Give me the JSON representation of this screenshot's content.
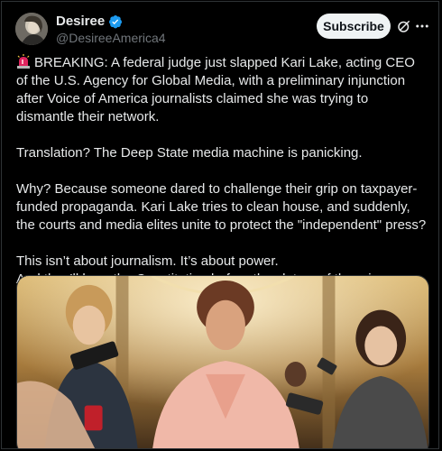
{
  "author": {
    "display_name": "Desiree",
    "handle": "@DesireeAmerica4",
    "verified": true
  },
  "actions": {
    "subscribe_label": "Subscribe"
  },
  "icons": {
    "verified": "verified-badge-icon",
    "grok": "grok-icon",
    "more": "more-options-icon",
    "siren": "siren-emoji-icon"
  },
  "tweet": {
    "paragraphs": [
      "BREAKING: A federal judge just slapped Kari Lake, acting CEO of the U.S. Agency for Global Media, with a preliminary injunction after Voice of America journalists claimed she was trying to dismantle their network.",
      "Translation? The Deep State media machine is panicking.",
      "Why? Because someone dared to challenge their grip on taxpayer-funded propaganda. Kari Lake tries to clean house, and suddenly, the courts and media elites unite to protect the \"independent\" press?",
      "This isn’t about journalism. It’s about power.",
      "And they’ll burn the Constitution before they let go of the mic."
    ]
  },
  "colors": {
    "background": "#000000",
    "text": "#e7e9ea",
    "secondary_text": "#71767b",
    "verified_blue": "#1d9bf0",
    "subscribe_bg": "#eff3f4"
  }
}
